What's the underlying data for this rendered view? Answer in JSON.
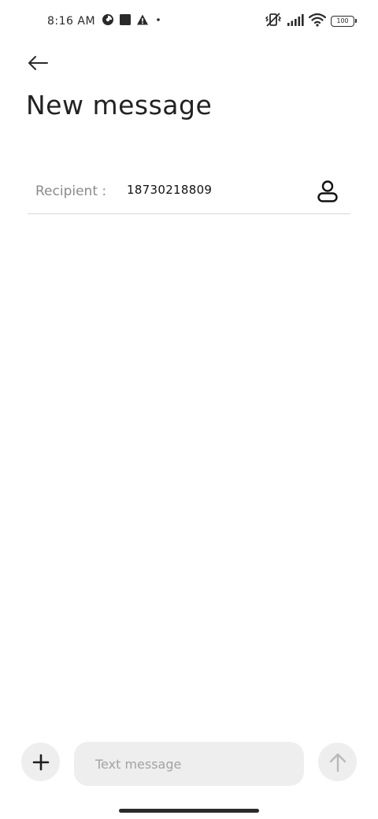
{
  "status_bar": {
    "time": "8:16 AM",
    "battery_level": "100",
    "icons_left": [
      "data-saver-icon",
      "square-notification-icon",
      "warning-icon",
      "dot-icon"
    ],
    "icons_right": [
      "vibrate-off-icon",
      "signal-icon",
      "wifi-icon",
      "battery-icon"
    ]
  },
  "header": {
    "title": "New message"
  },
  "recipient": {
    "label": "Recipient :",
    "value": "18730218809"
  },
  "composer": {
    "placeholder": "Text message"
  },
  "colors": {
    "background": "#ffffff",
    "pill_background": "#eeeeee",
    "divider": "#d9d9d9"
  }
}
